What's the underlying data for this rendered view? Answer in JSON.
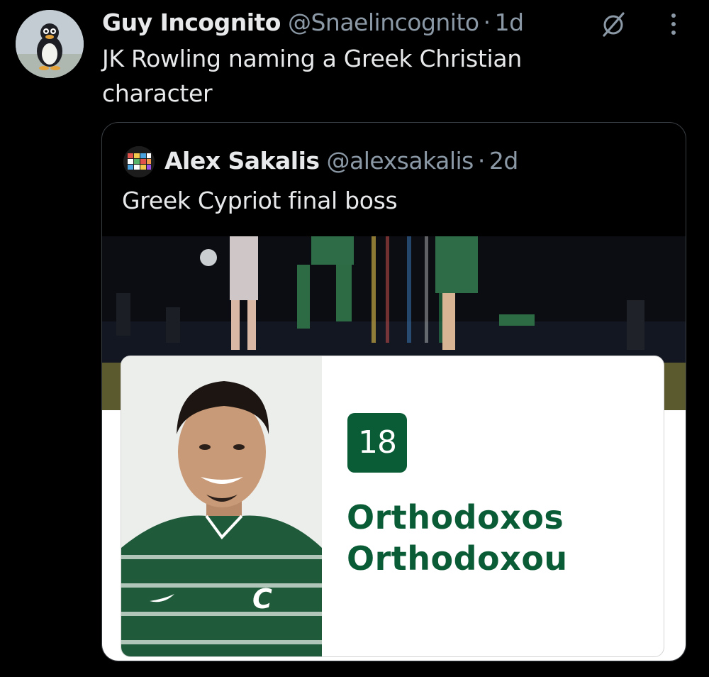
{
  "tweet": {
    "display_name": "Guy Incognito",
    "handle": "@Snaelincognito",
    "separator": "·",
    "time": "1d",
    "text": "JK Rowling naming a Greek Christian character",
    "avatar_icon": "penguin-avatar",
    "actions": {
      "grok_icon": "grok-icon",
      "more_icon": "more-options-icon"
    }
  },
  "quoted_tweet": {
    "display_name": "Alex Sakalis",
    "handle": "@alexsakalis",
    "separator": "·",
    "time": "2d",
    "text": "Greek Cypriot final boss",
    "avatar_icon": "colorful-tiles-avatar",
    "media": {
      "jersey_number": "18",
      "player_name_line1": "Orthodoxos",
      "player_name_line2": "Orthodoxou",
      "accent_color": "#0a5c36"
    }
  },
  "colors": {
    "background": "#000000",
    "text_primary": "#e7e9ea",
    "text_secondary": "#8b98a5",
    "border": "#3a3f44"
  }
}
